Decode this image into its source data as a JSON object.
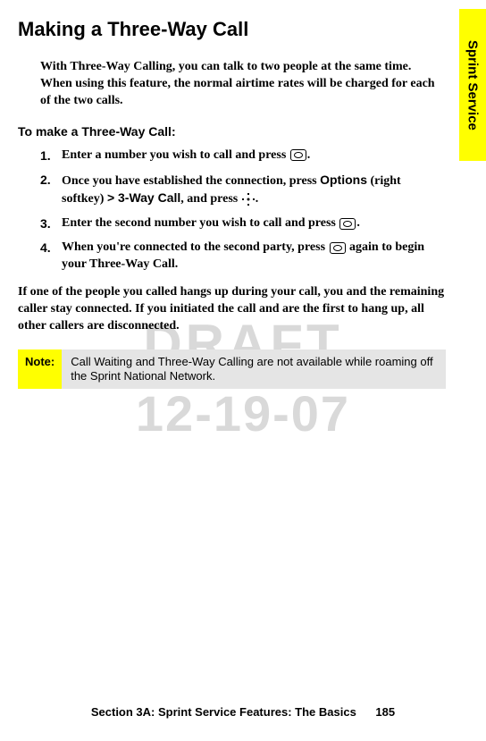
{
  "sideTab": "Sprint Service",
  "title": "Making a Three-Way Call",
  "intro": "With Three-Way Calling, you can talk to two people at the same time. When using this feature, the normal airtime rates will be charged for each of the two calls.",
  "subheading": "To make a Three-Way Call:",
  "steps": [
    {
      "num": "1.",
      "before": "Enter a number you wish to call and press ",
      "after": "."
    },
    {
      "num": "2.",
      "before": "Once you have established the connection, press ",
      "uiPrefix": "Options",
      "mid1": " (right softkey) ",
      "uiMid": "> 3-Way Call",
      "mid2": ", and press ",
      "after": "."
    },
    {
      "num": "3.",
      "before": "Enter the second number you wish to call and press ",
      "after": "."
    },
    {
      "num": "4.",
      "before": "When you're connected to the second party, press ",
      "after": " again to begin your Three-Way Call."
    }
  ],
  "paragraph": "If one of the people you called hangs up during your call, you and the remaining caller stay connected. If you initiated the call and are the first to hang up, all other callers are disconnected.",
  "note": {
    "label": "Note:",
    "text": "Call Waiting and Three-Way Calling are not available while roaming off the Sprint National Network."
  },
  "footer": {
    "section": "Section 3A: Sprint Service Features: The Basics",
    "pageNum": "185"
  },
  "watermark": {
    "draft": "DRAFT",
    "date": "12-19-07"
  }
}
